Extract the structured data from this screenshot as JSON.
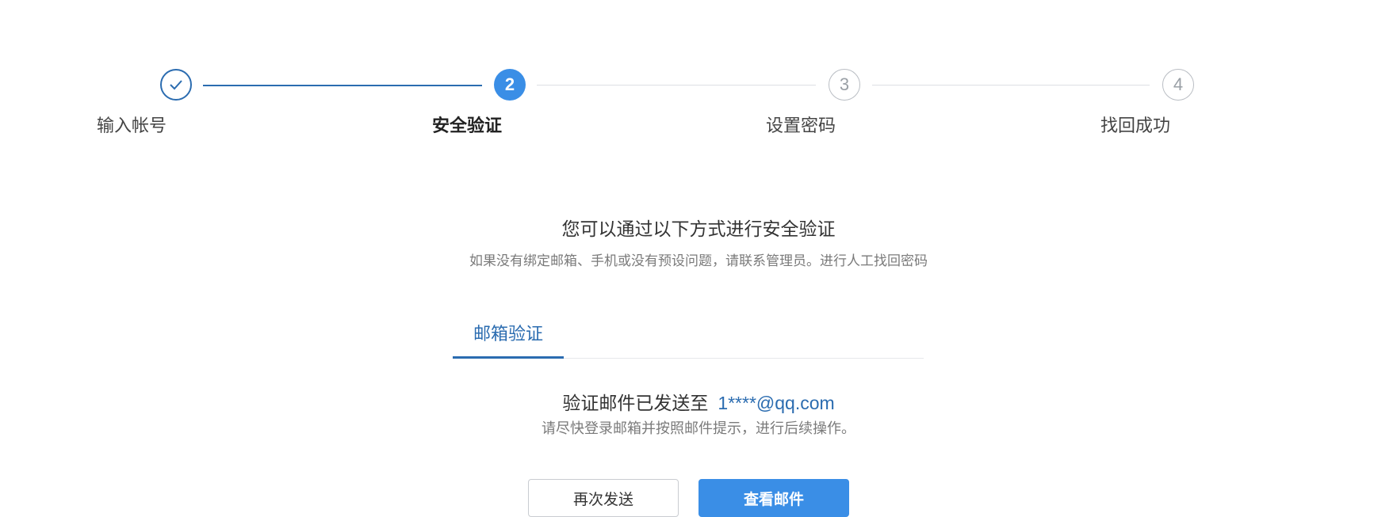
{
  "steps": [
    {
      "number": "1",
      "label": "输入帐号",
      "state": "done",
      "icon": "check-icon"
    },
    {
      "number": "2",
      "label": "安全验证",
      "state": "active"
    },
    {
      "number": "3",
      "label": "设置密码",
      "state": "todo"
    },
    {
      "number": "4",
      "label": "找回成功",
      "state": "todo"
    }
  ],
  "intro": {
    "title": "您可以通过以下方式进行安全验证",
    "subtitle": "如果没有绑定邮箱、手机或没有预设问题，请联系管理员。进行人工找回密码"
  },
  "tabs": [
    {
      "label": "邮箱验证",
      "active": true
    }
  ],
  "verification": {
    "sent_text": "验证邮件已发送至",
    "email": "1****@qq.com",
    "hint": "请尽快登录邮箱并按照邮件提示，进行后续操作。"
  },
  "buttons": {
    "resend": "再次发送",
    "view_mail": "查看邮件"
  },
  "colors": {
    "accent": "#2b6cb0",
    "primary_button": "#3a8ee6",
    "inactive": "#9aa0a6"
  }
}
